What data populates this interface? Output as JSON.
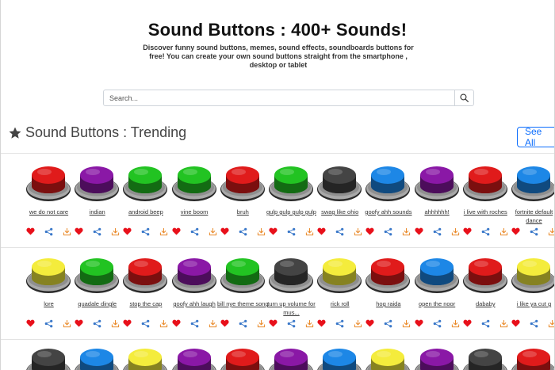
{
  "header": {
    "title": "Sound Buttons : 400+ Sounds!",
    "description": "Discover funny sound buttons, memes, sound effects, soundboards buttons for free! You can create your own sound buttons straight from the smartphone , desktop or tablet"
  },
  "search": {
    "placeholder": "Search..."
  },
  "section": {
    "title": "Sound Buttons : Trending",
    "see_all": "See All"
  },
  "colors": {
    "red": "#e01b1b",
    "purple": "#8a18a6",
    "green": "#22c322",
    "black": "#444444",
    "blue": "#1d87e6",
    "yellow": "#f4ec3c",
    "heart": "#e8101a",
    "share": "#3a78c9",
    "download": "#e98a2a"
  },
  "rows": [
    [
      {
        "label": "we do not care",
        "color": "red"
      },
      {
        "label": "indian",
        "color": "purple"
      },
      {
        "label": "android beep",
        "color": "green"
      },
      {
        "label": "vine boom",
        "color": "green"
      },
      {
        "label": "bruh",
        "color": "red"
      },
      {
        "label": "gulp gulp gulp gulp",
        "color": "green"
      },
      {
        "label": "swag like ohio",
        "color": "black"
      },
      {
        "label": "goofy ahh sounds",
        "color": "blue"
      },
      {
        "label": "ahhhhhh!",
        "color": "purple"
      },
      {
        "label": "i live with roches",
        "color": "red"
      },
      {
        "label": "fortnite default dance",
        "color": "blue"
      }
    ],
    [
      {
        "label": "lore",
        "color": "yellow"
      },
      {
        "label": "quadale dingle",
        "color": "green"
      },
      {
        "label": "stop the cap",
        "color": "red"
      },
      {
        "label": "goofy ahh laugh",
        "color": "purple"
      },
      {
        "label": "bill nye theme song",
        "color": "green"
      },
      {
        "label": "turn up volume for mus...",
        "color": "black"
      },
      {
        "label": "rick roll",
        "color": "yellow"
      },
      {
        "label": "hog raida",
        "color": "red"
      },
      {
        "label": "open the noor",
        "color": "blue"
      },
      {
        "label": "dababy",
        "color": "red"
      },
      {
        "label": "i like ya cut g",
        "color": "yellow"
      }
    ],
    [
      {
        "label": "",
        "color": "black"
      },
      {
        "label": "",
        "color": "blue"
      },
      {
        "label": "",
        "color": "yellow"
      },
      {
        "label": "",
        "color": "purple"
      },
      {
        "label": "",
        "color": "red"
      },
      {
        "label": "",
        "color": "purple"
      },
      {
        "label": "",
        "color": "blue"
      },
      {
        "label": "",
        "color": "yellow"
      },
      {
        "label": "",
        "color": "purple"
      },
      {
        "label": "",
        "color": "black"
      },
      {
        "label": "",
        "color": "red"
      }
    ]
  ],
  "icons": {
    "star": "star-icon",
    "search": "search-icon",
    "heart": "heart-icon",
    "share": "share-icon",
    "download": "download-icon"
  }
}
